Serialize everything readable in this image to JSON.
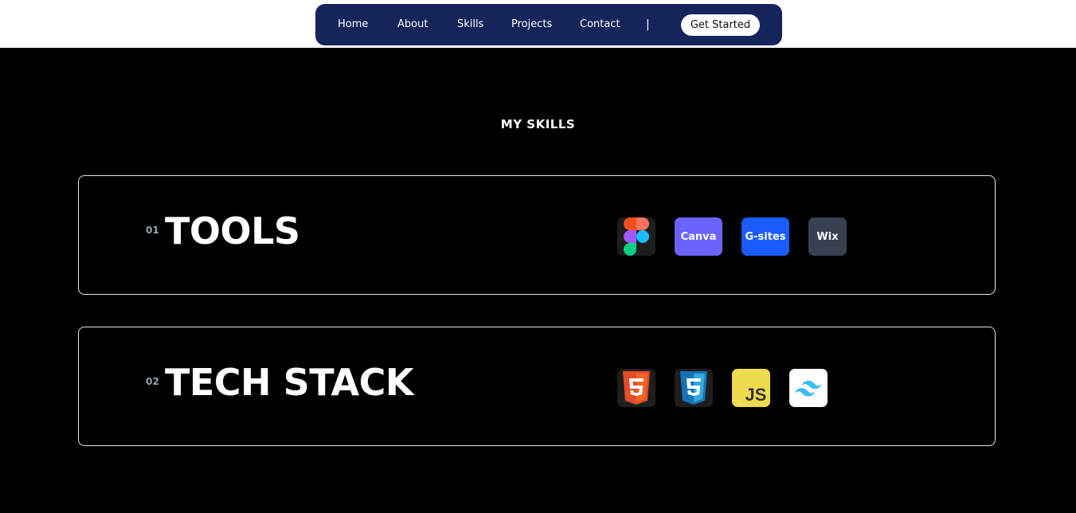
{
  "nav": {
    "links": [
      "Home",
      "About",
      "Skills",
      "Projects",
      "Contact"
    ],
    "separator": "|",
    "cta": "Get Started"
  },
  "skills": {
    "title": "MY SKILLS",
    "cards": [
      {
        "number": "01",
        "heading": "TOOLS",
        "items": [
          {
            "label": "",
            "icon": "figma-icon",
            "bg": "#1e1e1e"
          },
          {
            "label": "Canva",
            "icon": "canva-icon",
            "bg": "#6c63ff"
          },
          {
            "label": "G-sites",
            "icon": "google-sites-icon",
            "bg": "#1a5cff"
          },
          {
            "label": "Wix",
            "icon": "wix-icon",
            "bg": "#374151"
          }
        ]
      },
      {
        "number": "02",
        "heading": "TECH STACK",
        "items": [
          {
            "label": "",
            "icon": "html5-icon",
            "bg": "#1e1e1e"
          },
          {
            "label": "",
            "icon": "css3-icon",
            "bg": "#1e1e1e"
          },
          {
            "label": "",
            "icon": "javascript-icon",
            "bg": "#f0db4f"
          },
          {
            "label": "",
            "icon": "tailwind-icon",
            "bg": "#ffffff"
          }
        ]
      }
    ]
  },
  "colors": {
    "nav_bg": "#15245a",
    "page_bg": "#000000",
    "accent_html": "#e44d26",
    "accent_css": "#1572b6",
    "accent_tailwind": "#38bdf8"
  }
}
